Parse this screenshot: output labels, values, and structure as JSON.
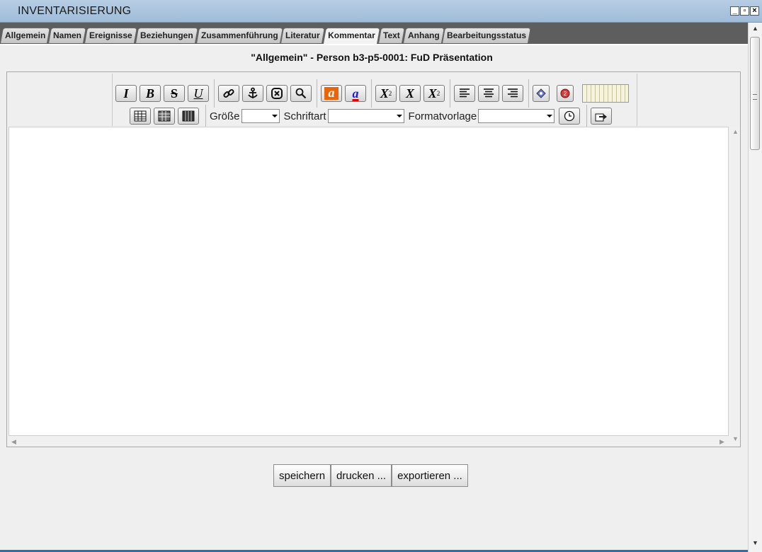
{
  "window": {
    "title": "INVENTARISIERUNG",
    "controls": [
      "minimize-icon",
      "maximize-icon",
      "close-icon"
    ]
  },
  "tabs": [
    {
      "label": "Allgemein",
      "active": false
    },
    {
      "label": "Namen",
      "active": false
    },
    {
      "label": "Ereignisse",
      "active": false
    },
    {
      "label": "Beziehungen",
      "active": false
    },
    {
      "label": "Zusammenführung",
      "active": false
    },
    {
      "label": "Literatur",
      "active": false
    },
    {
      "label": "Kommentar",
      "active": true
    },
    {
      "label": "Text",
      "active": false
    },
    {
      "label": "Anhang",
      "active": false
    },
    {
      "label": "Bearbeitungsstatus",
      "active": false
    }
  ],
  "heading": "\"Allgemein\" - Person b3-p5-0001: FuD Präsentation",
  "editor": {
    "size_label": "Größe",
    "size_value": "",
    "font_label": "Schriftart",
    "font_value": "",
    "style_label": "Formatvorlage",
    "style_value": "",
    "content": ""
  },
  "buttons": {
    "save": "speichern",
    "print": "drucken ...",
    "export": "exportieren ..."
  },
  "colors": {
    "titlebar": "#a9c3dd",
    "tabbar": "#5e5e5e",
    "panel": "#efefef",
    "highlight": "#e8650a",
    "font_color": "#1a1adc"
  }
}
